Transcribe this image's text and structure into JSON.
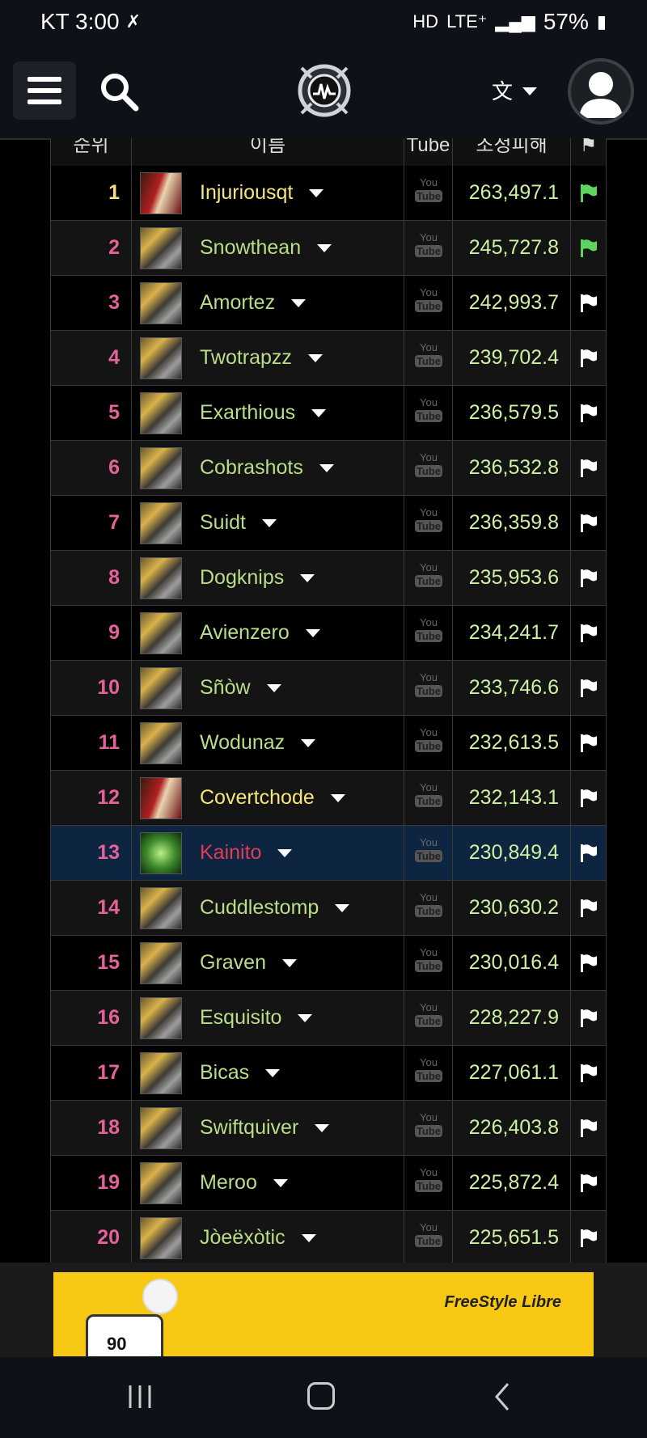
{
  "status_bar": {
    "carrier_time": "KT 3:00",
    "network": "LTE⁺",
    "battery": "57%"
  },
  "table": {
    "headers": [
      "순위",
      "이름",
      "Tube",
      "조정피해",
      ""
    ],
    "rows": [
      {
        "rank": "1",
        "name": "Injuriousqt",
        "score": "263,497.1",
        "flag_color": "#5dd45d"
      },
      {
        "rank": "2",
        "name": "Snowthean",
        "score": "245,727.8",
        "flag_color": "#5dd45d"
      },
      {
        "rank": "3",
        "name": "Amortez",
        "score": "242,993.7",
        "flag_color": "#ffffff"
      },
      {
        "rank": "4",
        "name": "Twotrapzz",
        "score": "239,702.4",
        "flag_color": "#ffffff"
      },
      {
        "rank": "5",
        "name": "Exarthious",
        "score": "236,579.5",
        "flag_color": "#ffffff"
      },
      {
        "rank": "6",
        "name": "Cobrashots",
        "score": "236,532.8",
        "flag_color": "#ffffff"
      },
      {
        "rank": "7",
        "name": "Suidt",
        "score": "236,359.8",
        "flag_color": "#ffffff"
      },
      {
        "rank": "8",
        "name": "Dogknips",
        "score": "235,953.6",
        "flag_color": "#ffffff"
      },
      {
        "rank": "9",
        "name": "Avienzero",
        "score": "234,241.7",
        "flag_color": "#ffffff"
      },
      {
        "rank": "10",
        "name": "Sñòw",
        "score": "233,746.6",
        "flag_color": "#ffffff"
      },
      {
        "rank": "11",
        "name": "Wodunaz",
        "score": "232,613.5",
        "flag_color": "#ffffff"
      },
      {
        "rank": "12",
        "name": "Covertchode",
        "score": "232,143.1",
        "flag_color": "#ffffff"
      },
      {
        "rank": "13",
        "name": "Kainito",
        "score": "230,849.4",
        "flag_color": "#ffffff"
      },
      {
        "rank": "14",
        "name": "Cuddlestomp",
        "score": "230,630.2",
        "flag_color": "#ffffff"
      },
      {
        "rank": "15",
        "name": "Graven",
        "score": "230,016.4",
        "flag_color": "#ffffff"
      },
      {
        "rank": "16",
        "name": "Esquisito",
        "score": "228,227.9",
        "flag_color": "#ffffff"
      },
      {
        "rank": "17",
        "name": "Bicas",
        "score": "227,061.1",
        "flag_color": "#ffffff"
      },
      {
        "rank": "18",
        "name": "Swiftquiver",
        "score": "226,403.8",
        "flag_color": "#ffffff"
      },
      {
        "rank": "19",
        "name": "Meroo",
        "score": "225,872.4",
        "flag_color": "#ffffff"
      },
      {
        "rank": "20",
        "name": "Jòeëxòtic",
        "score": "225,651.5",
        "flag_color": "#ffffff"
      }
    ],
    "youtube_label_top": "You",
    "youtube_label_bottom": "Tube"
  },
  "ad": {
    "brand": "FreeStyle Libre",
    "glucose_value": "90"
  }
}
